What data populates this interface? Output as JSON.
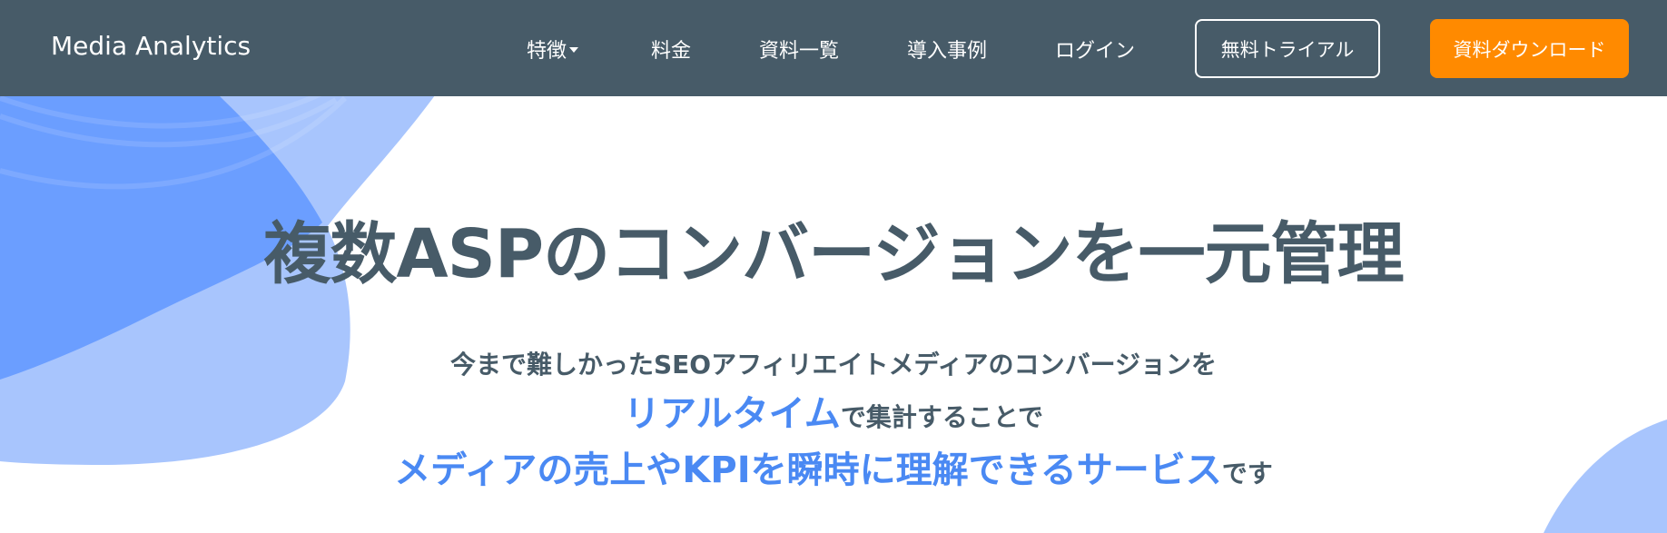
{
  "navbar": {
    "brand": "Media Analytics",
    "items": [
      {
        "label": "特徴",
        "has_dropdown": true
      },
      {
        "label": "料金"
      },
      {
        "label": "資料一覧"
      },
      {
        "label": "導入事例"
      },
      {
        "label": "ログイン"
      }
    ],
    "trial_button": "無料トライアル",
    "download_button": "資料ダウンロード"
  },
  "hero": {
    "headline": "複数ASPのコンバージョンを一元管理",
    "line1": "今まで難しかったSEOアフィリエイトメディアのコンバージョンを",
    "line2_accent": "リアルタイム",
    "line2_rest": "で集計することで",
    "line3_accent": "メディアの売上やKPIを瞬時に理解できるサービス",
    "line3_rest": "です"
  },
  "colors": {
    "navbar_bg": "#475b68",
    "text_dark": "#475b68",
    "accent_blue": "#4a89f3",
    "download_orange": "#ff8a00",
    "blob_dark": "#6b9eff",
    "blob_light": "#a8c5fd"
  }
}
